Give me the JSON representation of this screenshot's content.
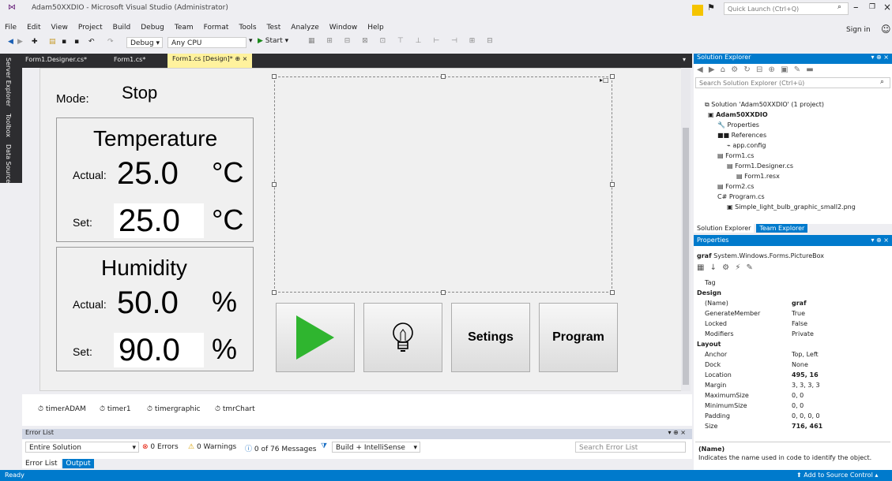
{
  "window": {
    "title": "Adam50XXDIO - Microsoft Visual Studio (Administrator)",
    "quick_launch_placeholder": "Quick Launch (Ctrl+Q)",
    "sign_in": "Sign in"
  },
  "menu": [
    "File",
    "Edit",
    "View",
    "Project",
    "Build",
    "Debug",
    "Team",
    "Format",
    "Tools",
    "Test",
    "Analyze",
    "Window",
    "Help"
  ],
  "toolbar": {
    "config": "Debug",
    "platform": "Any CPU",
    "start": "Start"
  },
  "left_tabs": [
    "Server Explorer",
    "Toolbox",
    "Data Sources"
  ],
  "doc_tabs": [
    "Form1.Designer.cs*",
    "Form1.cs*",
    "Form1.cs [Design]*"
  ],
  "form": {
    "mode_label": "Mode:",
    "mode_value": "Stop",
    "temp_title": "Temperature",
    "actual_label": "Actual:",
    "set_label": "Set:",
    "temp_actual": "25.0",
    "temp_set": "25.0",
    "temp_unit": "°C",
    "hum_title": "Humidity",
    "hum_actual": "50.0",
    "hum_set": "90.0",
    "hum_unit": "%",
    "btn_settings": "Setings",
    "btn_program": "Program"
  },
  "component_tray": [
    "timerADAM",
    "timer1",
    "timergraphic",
    "tmrChart"
  ],
  "error_list": {
    "title": "Error List",
    "scope": "Entire Solution",
    "errors": "0 Errors",
    "warnings": "0 Warnings",
    "messages": "0 of 76 Messages",
    "build": "Build + IntelliSense",
    "search": "Search Error List",
    "tab1": "Error List",
    "tab2": "Output"
  },
  "solution_explorer": {
    "title": "Solution Explorer",
    "search": "Search Solution Explorer (Ctrl+ü)",
    "items": [
      "Solution 'Adam50XXDIO' (1 project)",
      "Adam50XXDIO",
      "Properties",
      "References",
      "app.config",
      "Form1.cs",
      "Form1.Designer.cs",
      "Form1.resx",
      "Form2.cs",
      "Program.cs",
      "Simple_light_bulb_graphic_small2.png"
    ],
    "tab1": "Solution Explorer",
    "tab2": "Team Explorer"
  },
  "properties": {
    "title": "Properties",
    "object_name": "graf",
    "object_type": "System.Windows.Forms.PictureBox",
    "rows": [
      {
        "name": "Tag",
        "value": "",
        "cat": false
      },
      {
        "name": "Design",
        "value": "",
        "cat": true
      },
      {
        "name": "(Name)",
        "value": "graf",
        "cat": false,
        "bold": true
      },
      {
        "name": "GenerateMember",
        "value": "True",
        "cat": false
      },
      {
        "name": "Locked",
        "value": "False",
        "cat": false
      },
      {
        "name": "Modifiers",
        "value": "Private",
        "cat": false
      },
      {
        "name": "Layout",
        "value": "",
        "cat": true
      },
      {
        "name": "Anchor",
        "value": "Top, Left",
        "cat": false
      },
      {
        "name": "Dock",
        "value": "None",
        "cat": false
      },
      {
        "name": "Location",
        "value": "495, 16",
        "cat": false,
        "bold": true
      },
      {
        "name": "Margin",
        "value": "3, 3, 3, 3",
        "cat": false
      },
      {
        "name": "MaximumSize",
        "value": "0, 0",
        "cat": false
      },
      {
        "name": "MinimumSize",
        "value": "0, 0",
        "cat": false
      },
      {
        "name": "Padding",
        "value": "0, 0, 0, 0",
        "cat": false
      },
      {
        "name": "Size",
        "value": "716, 461",
        "cat": false,
        "bold": true
      }
    ],
    "desc_title": "(Name)",
    "desc_text": "Indicates the name used in code to identify the object."
  },
  "status": {
    "left": "Ready",
    "right": "Add to Source Control"
  }
}
